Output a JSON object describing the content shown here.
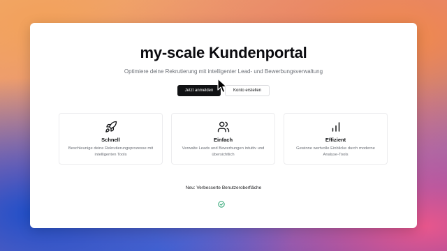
{
  "portal": {
    "title": "my-scale Kundenportal",
    "subtitle": "Optimiere deine Rekrutierung mit intelligenter Lead- und Bewerbungsverwaltung",
    "login_label": "Jetzt anmelden",
    "register_label": "Konto erstellen"
  },
  "features": [
    {
      "icon": "rocket-icon",
      "title": "Schnell",
      "desc": "Beschleunige deine Rekrutierungsprozesse mit intelligenten Tools"
    },
    {
      "icon": "users-icon",
      "title": "Einfach",
      "desc": "Verwalte Leads und Bewerbungen intuitiv und übersichtlich"
    },
    {
      "icon": "bar-chart-icon",
      "title": "Effizient",
      "desc": "Gewinne wertvolle Einblicke durch moderne Analyse-Tools"
    }
  ],
  "announcement": {
    "text": "Neu: Verbesserte Benutzeroberfläche",
    "icon": "check-circle-icon",
    "icon_color": "#22a06b"
  },
  "colors": {
    "primary_button": "#111214",
    "accent": "#22a06b"
  }
}
